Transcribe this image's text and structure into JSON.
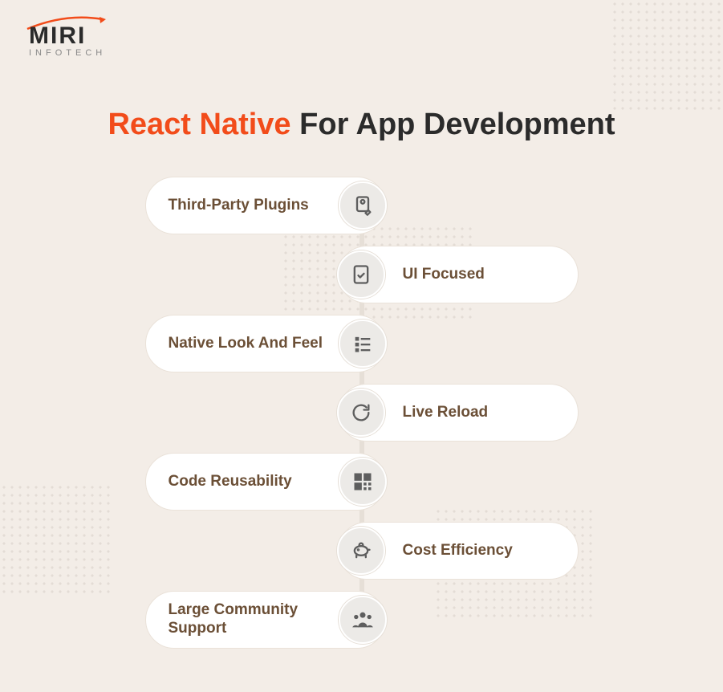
{
  "logo": {
    "name": "MIRI",
    "subtitle": "INFOTECH"
  },
  "title": {
    "accent": "React Native",
    "rest": "For App Development"
  },
  "items": [
    {
      "label": "Third-Party Plugins",
      "side": "left",
      "icon": "plugins-icon"
    },
    {
      "label": "UI Focused",
      "side": "right",
      "icon": "ui-icon"
    },
    {
      "label": "Native Look And Feel",
      "side": "left",
      "icon": "list-icon"
    },
    {
      "label": "Live Reload",
      "side": "right",
      "icon": "reload-icon"
    },
    {
      "label": "Code Reusability",
      "side": "left",
      "icon": "qr-icon"
    },
    {
      "label": "Cost Efficiency",
      "side": "right",
      "icon": "piggy-icon"
    },
    {
      "label": "Large Community Support",
      "side": "left",
      "icon": "users-icon"
    }
  ]
}
